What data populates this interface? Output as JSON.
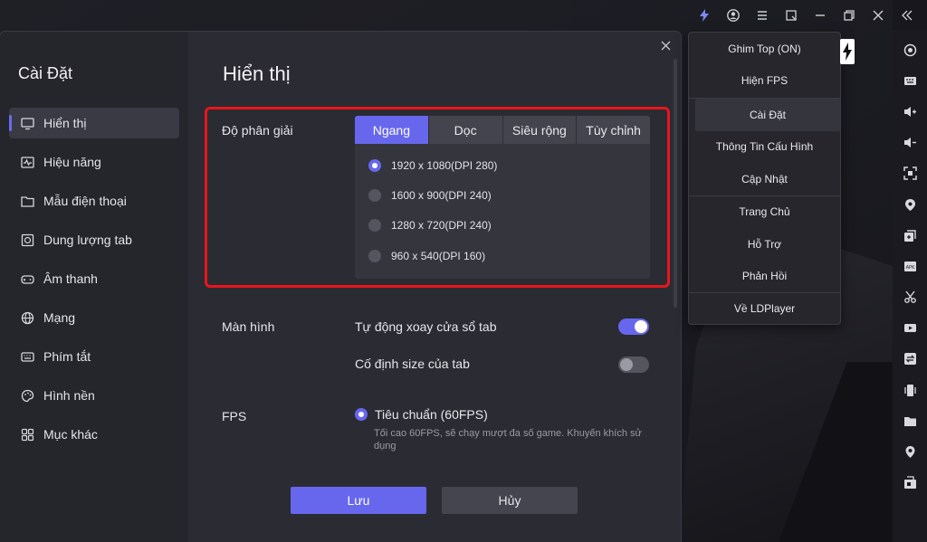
{
  "dialog": {
    "sidebar_title": "Cài Đặt",
    "content_title": "Hiển thị",
    "nav": [
      {
        "label": "Hiển thị",
        "icon": "monitor-icon",
        "active": true
      },
      {
        "label": "Hiệu năng",
        "icon": "performance-icon"
      },
      {
        "label": "Mẫu điện thoại",
        "icon": "phone-model-icon"
      },
      {
        "label": "Dung lượng tab",
        "icon": "storage-icon"
      },
      {
        "label": "Âm thanh",
        "icon": "gamepad-icon"
      },
      {
        "label": "Mạng",
        "icon": "globe-icon"
      },
      {
        "label": "Phím tắt",
        "icon": "keyboard-icon"
      },
      {
        "label": "Hình nền",
        "icon": "palette-icon"
      },
      {
        "label": "Mục khác",
        "icon": "grid-icon"
      }
    ],
    "resolution": {
      "label": "Độ phân giải",
      "tabs": [
        "Ngang",
        "Dọc",
        "Siêu rộng",
        "Tùy chỉnh"
      ],
      "active_tab": "Ngang",
      "options": [
        {
          "label": "1920 x 1080(DPI 280)",
          "selected": true
        },
        {
          "label": "1600 x 900(DPI 240)",
          "selected": false
        },
        {
          "label": "1280 x 720(DPI 240)",
          "selected": false
        },
        {
          "label": "960 x 540(DPI 160)",
          "selected": false
        }
      ]
    },
    "screen": {
      "label": "Màn hình",
      "auto_rotate_label": "Tự động xoay cửa sổ tab",
      "auto_rotate_on": true,
      "fixed_size_label": "Cố định size của tab",
      "fixed_size_on": false
    },
    "fps": {
      "label": "FPS",
      "option_label": "Tiêu chuẩn (60FPS)",
      "hint": "Tối cao 60FPS, sẽ chạy mượt đa số game. Khuyến khích sử dụng"
    },
    "save_label": "Lưu",
    "cancel_label": "Hủy"
  },
  "menu": {
    "items": [
      {
        "label": "Ghim Top (ON)"
      },
      {
        "label": "Hiện FPS"
      },
      {
        "label": "Cài Đặt",
        "selected": true
      },
      {
        "label": "Thông Tin Cấu Hình"
      },
      {
        "label": "Cập Nhật"
      },
      {
        "label": "Trang Chủ"
      },
      {
        "label": "Hỗ Trợ"
      },
      {
        "label": "Phản Hồi"
      },
      {
        "label": "Về LDPlayer"
      }
    ]
  },
  "colors": {
    "accent": "#6767ee",
    "highlight_border": "#e8161b",
    "dialog_bg": "#2b2b33",
    "sidebar_bg": "#25252c"
  }
}
